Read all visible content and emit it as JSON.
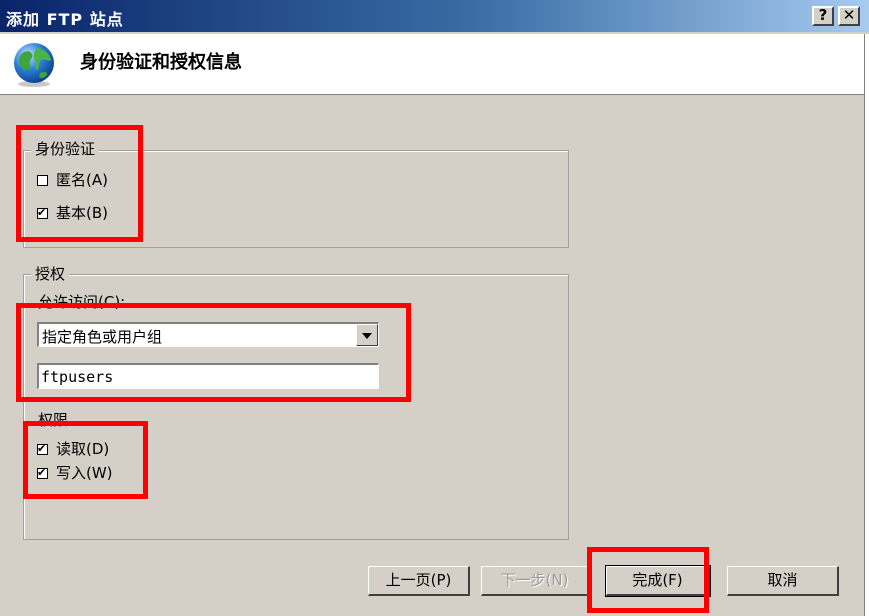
{
  "window": {
    "title": "添加 FTP 站点",
    "help_label": "?",
    "close_label": "✕"
  },
  "header": {
    "title": "身份验证和授权信息",
    "icon": "globe-icon"
  },
  "auth": {
    "legend": "身份验证",
    "anonymous": {
      "label": "匿名(A)",
      "checked": false
    },
    "basic": {
      "label": "基本(B)",
      "checked": true
    }
  },
  "authorization": {
    "legend": "授权",
    "allow_access_label": "允许访问(C):",
    "allow_access_value": "指定角色或用户组",
    "group_value": "ftpusers",
    "permissions_label": "权限",
    "read": {
      "label": "读取(D)",
      "checked": true
    },
    "write": {
      "label": "写入(W)",
      "checked": true
    }
  },
  "buttons": {
    "prev": "上一页(P)",
    "next": "下一步(N)",
    "finish": "完成(F)",
    "cancel": "取消"
  },
  "colors": {
    "highlight": "#ff0000",
    "titlebar": "#0a246a",
    "dialog_bg": "#d4d0c8"
  }
}
